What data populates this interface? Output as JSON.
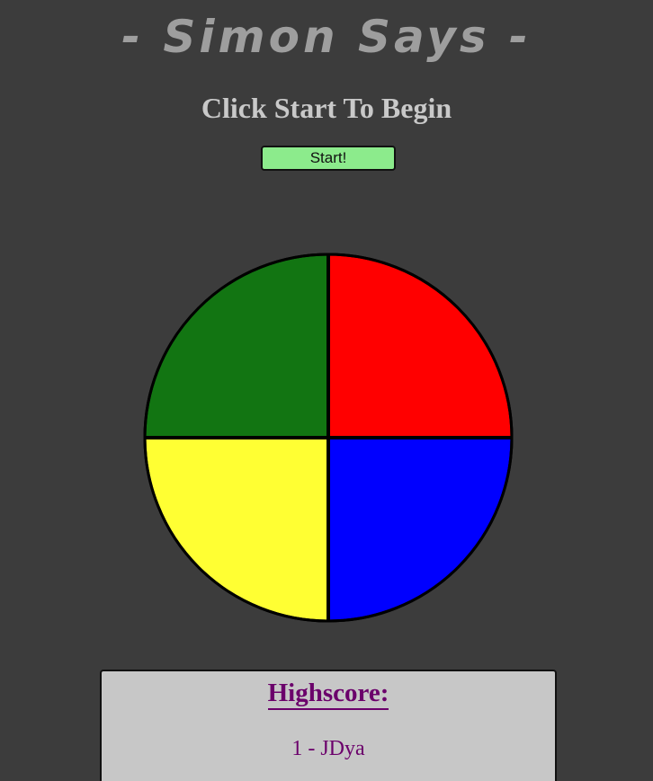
{
  "header": {
    "title": "- Simon Says -",
    "status": "Click Start To Begin",
    "start_label": "Start!"
  },
  "board": {
    "pads": [
      {
        "id": "green",
        "color": "#127512"
      },
      {
        "id": "red",
        "color": "#ff0000"
      },
      {
        "id": "yellow",
        "color": "#ffff33"
      },
      {
        "id": "blue",
        "color": "#0000ff"
      }
    ]
  },
  "highscore": {
    "title": "Highscore:",
    "entries": [
      "1 - JDya"
    ]
  },
  "colors": {
    "background": "#3c3c3c",
    "title": "#9e9e9e",
    "status": "#c9c9c9",
    "start_button": "#8ceb8c",
    "highscore_panel": "#c7c7c7",
    "highscore_text": "#6b006b"
  }
}
